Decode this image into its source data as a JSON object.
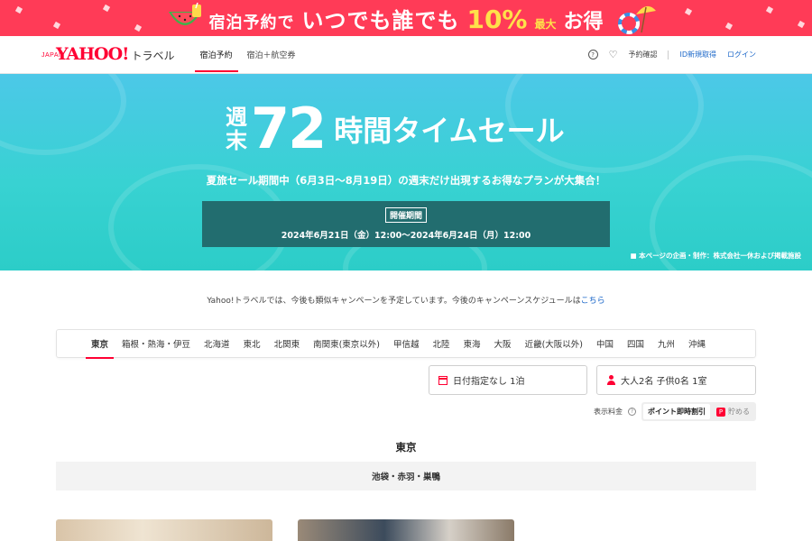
{
  "top_banner": {
    "promo_part1": "宿泊予約で",
    "promo_part2": "いつでも誰でも",
    "promo_percent": "10%",
    "promo_max": "最大",
    "promo_part4": "お得",
    "bg_color": "#ff3b57",
    "accent_color": "#ffe14a",
    "left_icon": "watermelon-drink-icon",
    "right_icon": "beach-umbrella-icon"
  },
  "header": {
    "logo_text": "YAHOO!",
    "logo_sub": "JAPAN",
    "logo_service": "トラベル",
    "nav": [
      {
        "label": "宿泊予約",
        "active": true
      },
      {
        "label": "宿泊＋航空券",
        "active": false
      }
    ],
    "right": {
      "help_icon": "question-circle-icon",
      "favorite_icon": "heart-icon",
      "reservation_label": "予約確認",
      "signup_label": "ID新規取得",
      "login_label": "ログイン"
    }
  },
  "hero": {
    "weekend_top": "週",
    "weekend_bottom": "末",
    "hours": "72",
    "title_rest": "時間タイムセール",
    "subtitle": "夏旅セール期間中（6月3日〜8月19日）の週末だけ出現するお得なプランが大集合！",
    "period_badge": "開催期間",
    "period": "2024年6月21日（金）12:00〜2024年6月24日（月）12:00",
    "note": "■ 本ページの企画・制作：株式会社一休および掲載施設",
    "box_color": "#226d6f"
  },
  "notice": {
    "text": "Yahoo!トラベルでは、今後も類似キャンペーンを予定しています。今後のキャンペーンスケジュールは",
    "link": "こちら"
  },
  "regions": {
    "items": [
      "東京",
      "箱根・熱海・伊豆",
      "北海道",
      "東北",
      "北関東",
      "南関東(東京以外)",
      "甲信越",
      "北陸",
      "東海",
      "大阪",
      "近畿(大阪以外)",
      "中国",
      "四国",
      "九州",
      "沖縄"
    ],
    "active_index": 0
  },
  "search": {
    "date_label": "日付指定なし 1泊",
    "date_icon": "calendar-icon",
    "guests_label": "大人2名 子供0名 1室",
    "guests_icon": "person-icon"
  },
  "price_display": {
    "label": "表示料金",
    "help_icon": "question-circle-icon",
    "option_active": "ポイント即時割引",
    "option_inactive": "貯める",
    "option_inactive_icon": "paypay-point-icon"
  },
  "listing": {
    "area_title": "東京",
    "sub_area": "池袋・赤羽・巣鴨"
  }
}
